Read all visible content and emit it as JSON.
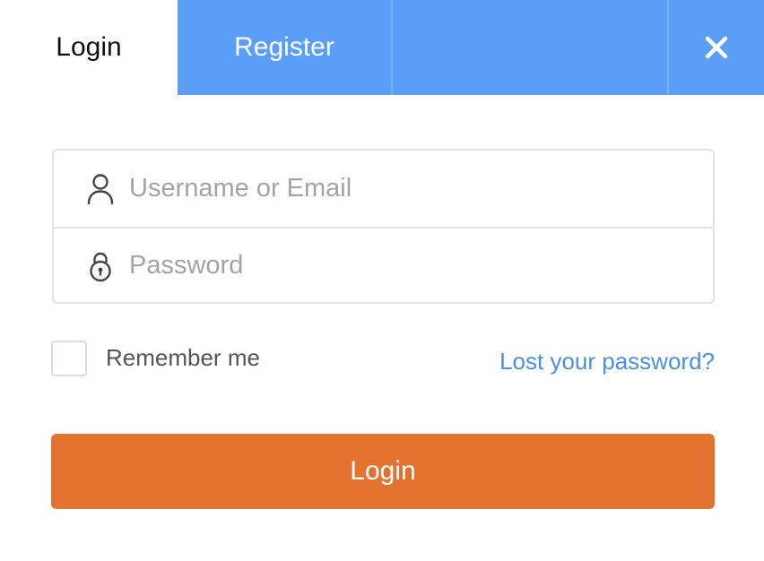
{
  "tabs": {
    "login_label": "Login",
    "register_label": "Register",
    "close_icon": "close-icon"
  },
  "form": {
    "username": {
      "icon": "user-icon",
      "value": "",
      "placeholder": "Username or Email"
    },
    "password": {
      "icon": "lock-icon",
      "value": "",
      "placeholder": "Password"
    },
    "remember_label": "Remember me",
    "remember_checked": false,
    "lost_password_label": "Lost your password?",
    "submit_label": "Login"
  },
  "colors": {
    "tab_accent": "#5b9ef8",
    "link": "#4a90e2",
    "submit": "#e2722e"
  }
}
